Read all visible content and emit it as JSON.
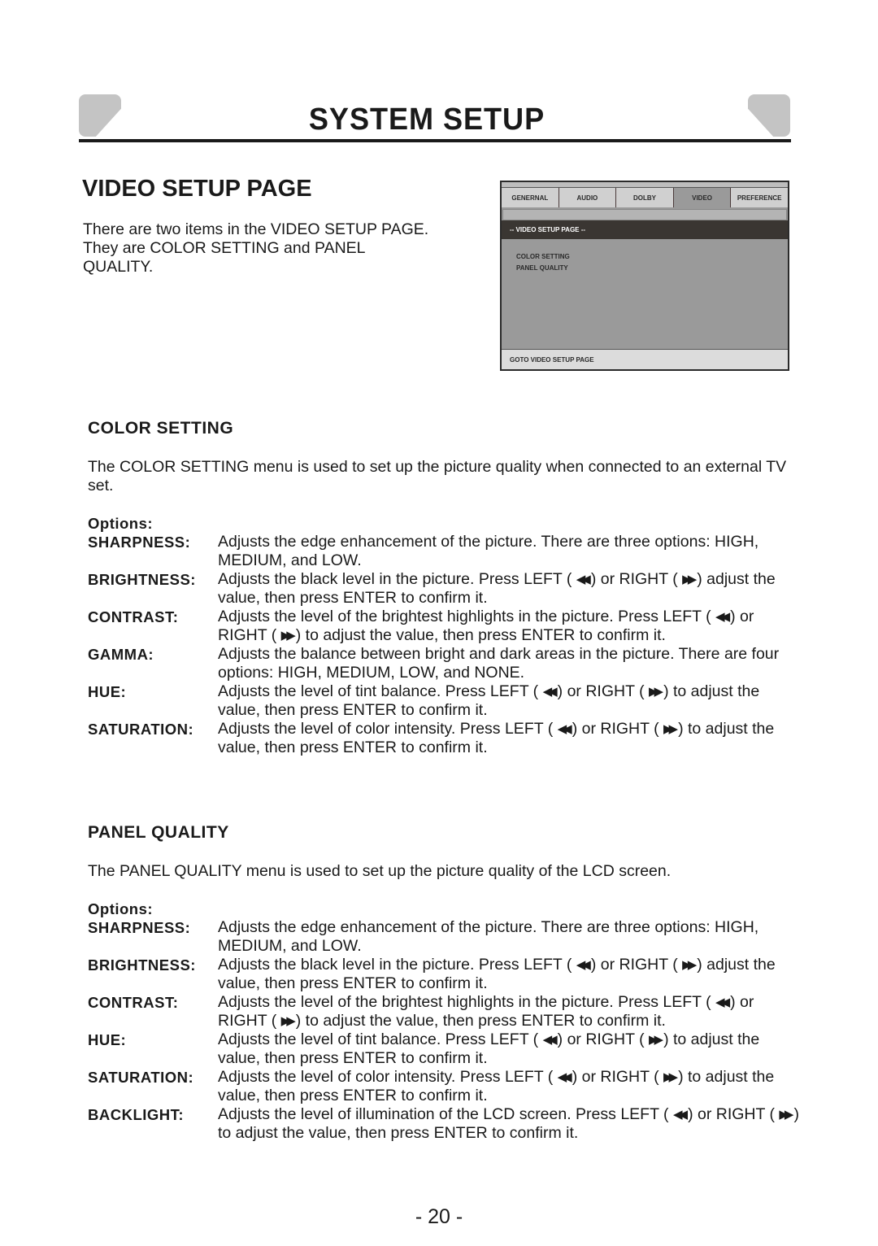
{
  "header": {
    "title": "SYSTEM SETUP"
  },
  "video_setup": {
    "title": "VIDEO SETUP PAGE",
    "intro": "There are two items in the VIDEO SETUP PAGE. They are COLOR SETTING and PANEL QUALITY."
  },
  "osd": {
    "tabs": [
      "GENERNAL",
      "AUDIO",
      "DOLBY",
      "VIDEO",
      "PREFERENCE"
    ],
    "active_tab": "VIDEO",
    "page_bar": "-- VIDEO SETUP PAGE --",
    "items": [
      "COLOR SETTING",
      "PANEL QUALITY"
    ],
    "footer": "GOTO VIDEO SETUP PAGE"
  },
  "icons": {
    "left": "rewind-icon ◀◀",
    "right": "fast-forward-icon ▶▶"
  },
  "color_setting": {
    "title": "COLOR SETTING",
    "description": "The COLOR SETTING menu is used to set up the picture quality when connected to an external TV set.",
    "options_label": "Options:",
    "options": [
      {
        "label": "SHARPNESS:",
        "pre": "Adjusts the edge enhancement of the picture. There are three options: HIGH, MEDIUM, and LOW.",
        "arrows": false
      },
      {
        "label": "BRIGHTNESS:",
        "pre": "Adjusts the black level in the picture. Press LEFT (",
        "mid": ") or RIGHT (",
        "post": ") adjust the value, then press ENTER to confirm it.",
        "arrows": true
      },
      {
        "label": "CONTRAST:",
        "pre": "Adjusts the level of the brightest highlights in the picture. Press LEFT (",
        "mid": ") or RIGHT (",
        "post": ") to adjust the value, then press ENTER to confirm it.",
        "arrows": true
      },
      {
        "label": "GAMMA:",
        "pre": "Adjusts the balance between bright and dark areas in the picture. There are four options: HIGH, MEDIUM, LOW, and NONE.",
        "arrows": false
      },
      {
        "label": "HUE:",
        "pre": "Adjusts the level of tint balance. Press LEFT (",
        "mid": ") or RIGHT (",
        "post": ") to adjust the value, then press ENTER to confirm it.",
        "arrows": true
      },
      {
        "label": "SATURATION:",
        "pre": "Adjusts the level of color intensity. Press LEFT (",
        "mid": ") or RIGHT (",
        "post": ") to adjust the value, then press ENTER to confirm it.",
        "arrows": true
      }
    ]
  },
  "panel_quality": {
    "title": "PANEL QUALITY",
    "description": "The PANEL QUALITY menu is used to set up the picture quality of the LCD screen.",
    "options_label": "Options:",
    "options": [
      {
        "label": "SHARPNESS:",
        "pre": "Adjusts the edge enhancement of the picture. There are three options: HIGH, MEDIUM, and LOW.",
        "arrows": false
      },
      {
        "label": "BRIGHTNESS:",
        "pre": "Adjusts the black level in the picture. Press LEFT (",
        "mid": ") or RIGHT (",
        "post": ") adjust the value, then press ENTER to confirm it.",
        "arrows": true
      },
      {
        "label": "CONTRAST:",
        "pre": "Adjusts the level of the brightest highlights in the picture. Press LEFT (",
        "mid": ") or RIGHT (",
        "post": ") to adjust the value, then press ENTER to confirm it.",
        "arrows": true
      },
      {
        "label": "HUE:",
        "pre": "Adjusts the level of tint balance. Press LEFT (",
        "mid": ") or RIGHT (",
        "post": ") to adjust the value, then press ENTER to confirm it.",
        "arrows": true
      },
      {
        "label": "SATURATION:",
        "pre": "Adjusts the level of color intensity. Press LEFT (",
        "mid": ") or RIGHT (",
        "post": ") to adjust the value, then press ENTER to confirm it.",
        "arrows": true
      },
      {
        "label": "BACKLIGHT:",
        "pre": "Adjusts the level of illumination of the LCD screen. Press LEFT (",
        "mid": ") or RIGHT (",
        "post": ") to adjust the value, then press ENTER to confirm it.",
        "arrows": true
      }
    ]
  },
  "footer": {
    "page_number": "- 20 -"
  }
}
